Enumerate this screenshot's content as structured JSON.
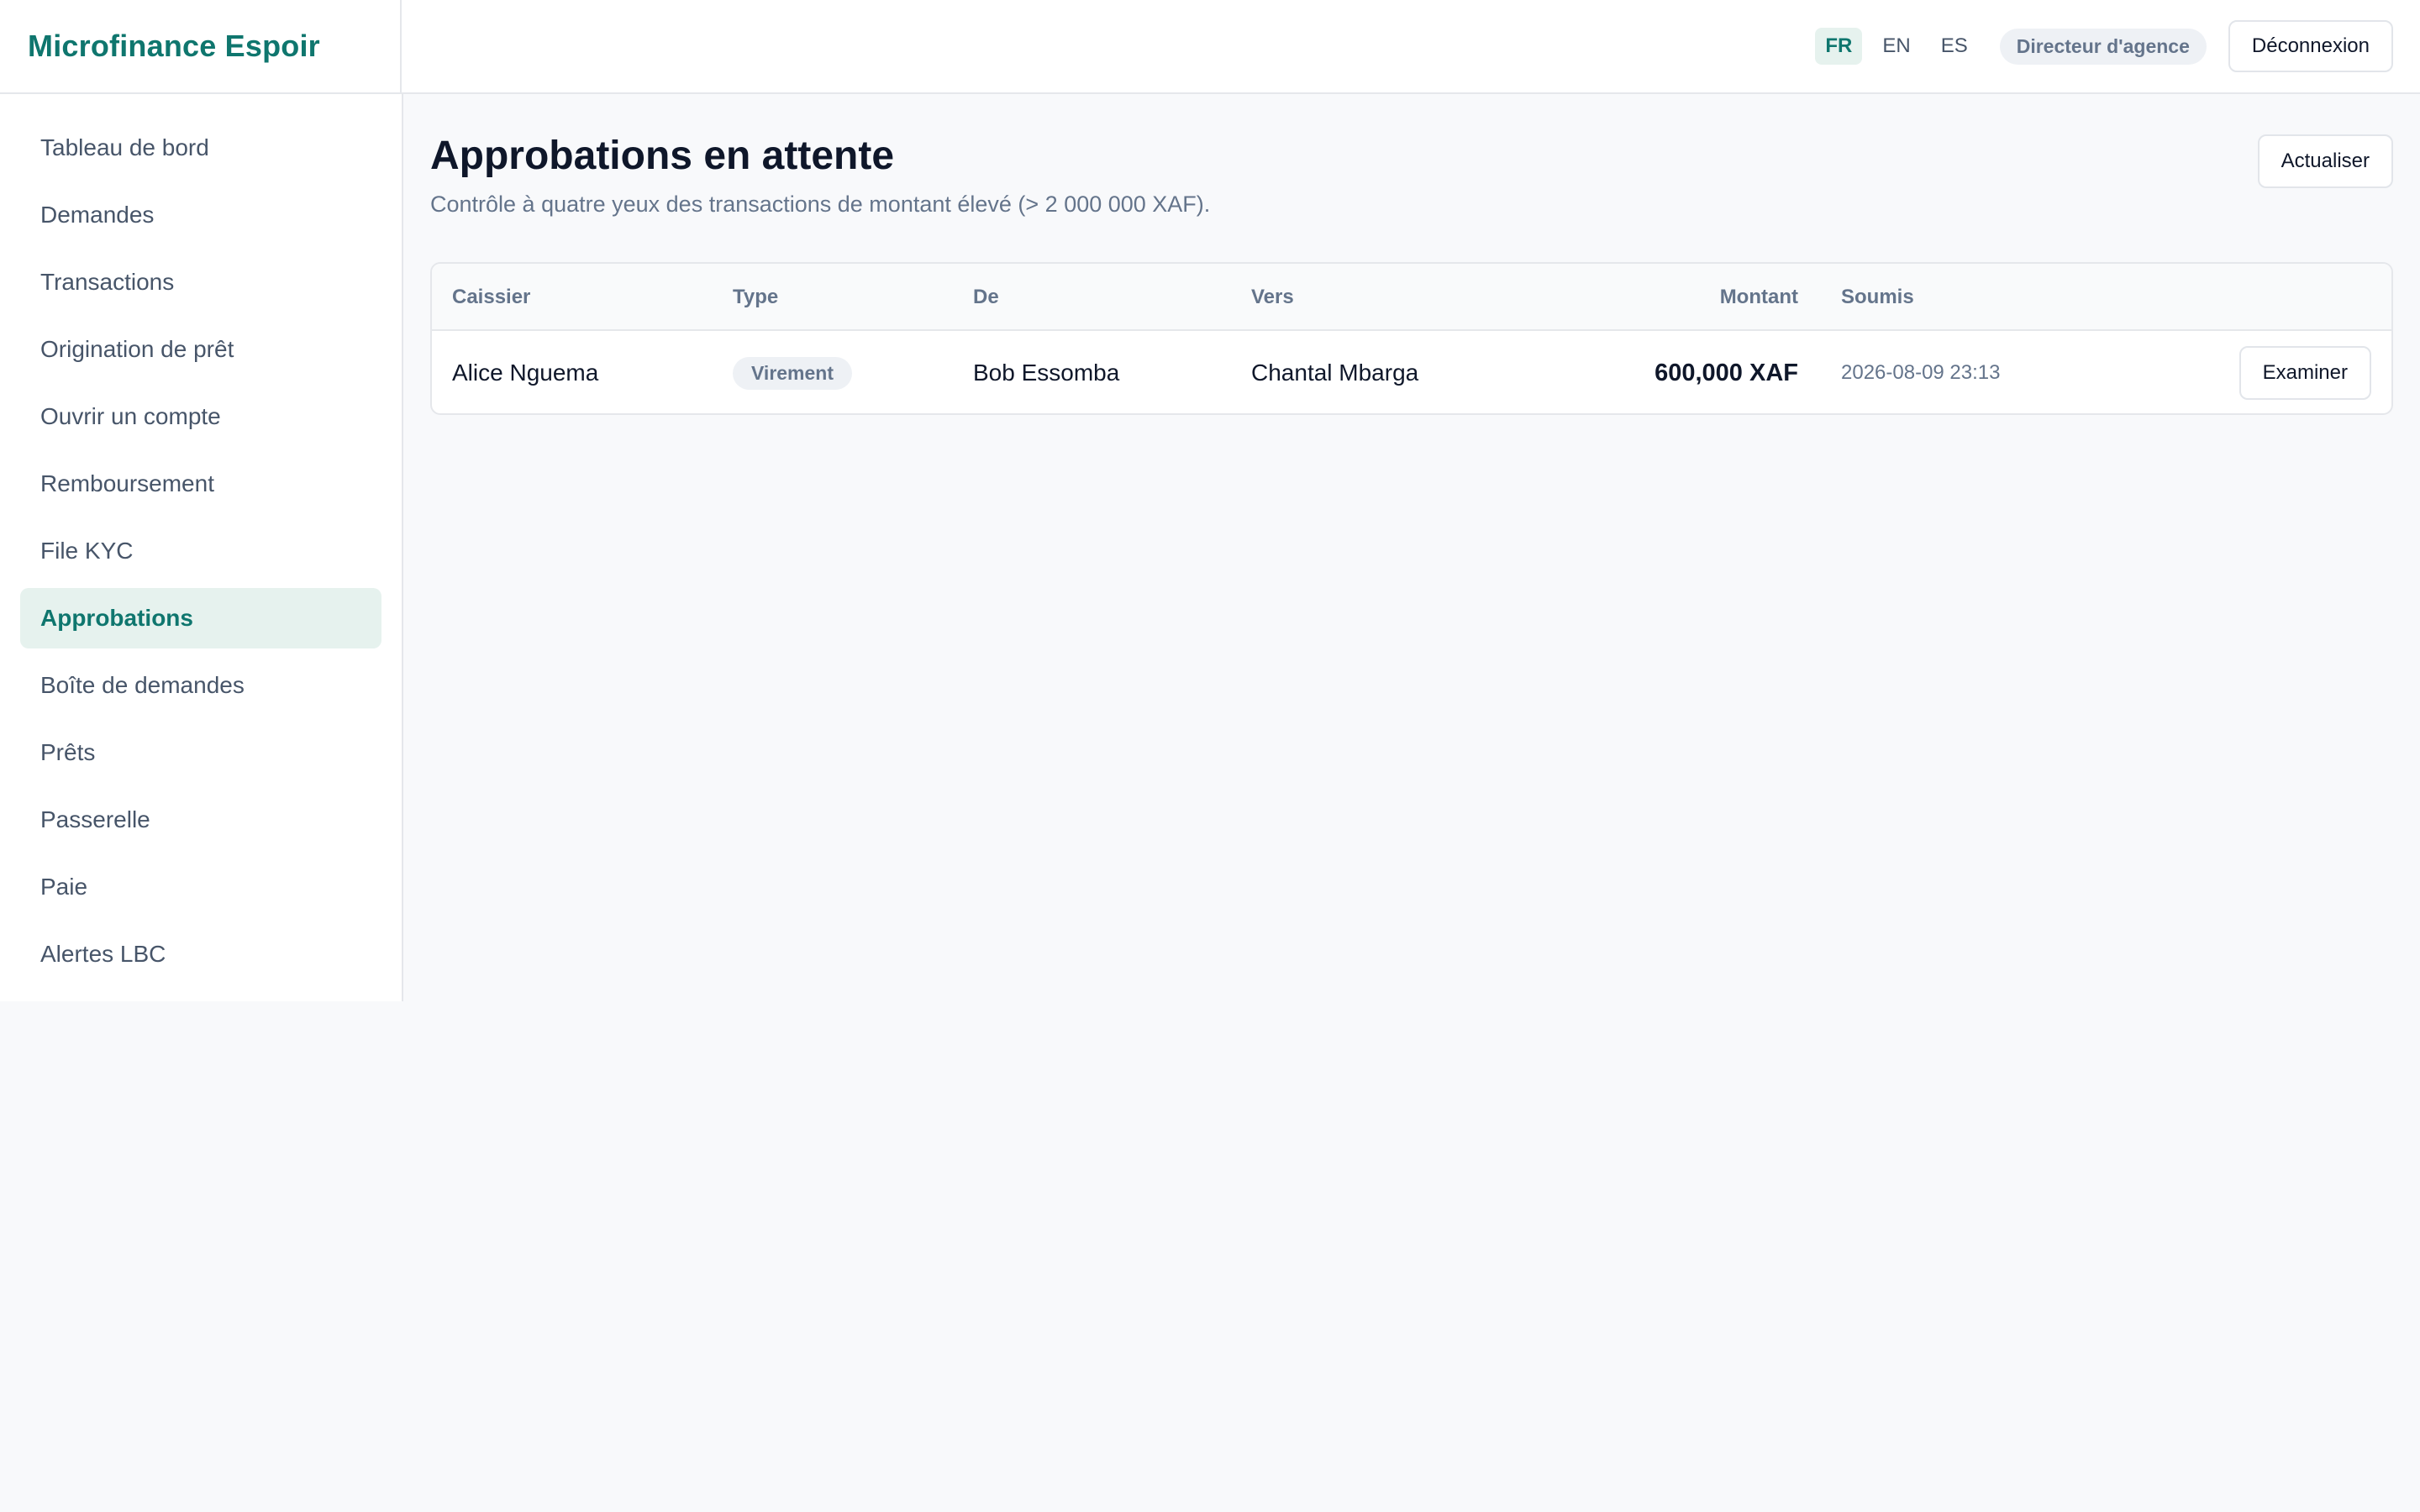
{
  "brand": "Microfinance Espoir",
  "header": {
    "languages": [
      {
        "code": "FR",
        "active": true
      },
      {
        "code": "EN",
        "active": false
      },
      {
        "code": "ES",
        "active": false
      }
    ],
    "role": "Directeur d'agence",
    "logout_label": "Déconnexion"
  },
  "sidebar": {
    "items": [
      {
        "label": "Tableau de bord",
        "active": false
      },
      {
        "label": "Demandes",
        "active": false
      },
      {
        "label": "Transactions",
        "active": false
      },
      {
        "label": "Origination de prêt",
        "active": false
      },
      {
        "label": "Ouvrir un compte",
        "active": false
      },
      {
        "label": "Remboursement",
        "active": false
      },
      {
        "label": "File KYC",
        "active": false
      },
      {
        "label": "Approbations",
        "active": true
      },
      {
        "label": "Boîte de demandes",
        "active": false
      },
      {
        "label": "Prêts",
        "active": false
      },
      {
        "label": "Passerelle",
        "active": false
      },
      {
        "label": "Paie",
        "active": false
      },
      {
        "label": "Alertes LBC",
        "active": false
      }
    ]
  },
  "main": {
    "title": "Approbations en attente",
    "subtitle": "Contrôle à quatre yeux des transactions de montant élevé (> 2 000 000 XAF).",
    "refresh_label": "Actualiser",
    "table": {
      "headers": {
        "cashier": "Caissier",
        "type": "Type",
        "from": "De",
        "to": "Vers",
        "amount": "Montant",
        "submitted": "Soumis"
      },
      "rows": [
        {
          "cashier": "Alice Nguema",
          "type": "Virement",
          "from": "Bob Essomba",
          "to": "Chantal Mbarga",
          "amount": "600,000 XAF",
          "submitted": "2026-08-09 23:13",
          "action_label": "Examiner"
        }
      ]
    }
  },
  "colors": {
    "accent": "#0f766e",
    "accent_bg": "#e6f2ee",
    "muted_text": "#64748b",
    "page_bg": "#f8f9fb"
  }
}
